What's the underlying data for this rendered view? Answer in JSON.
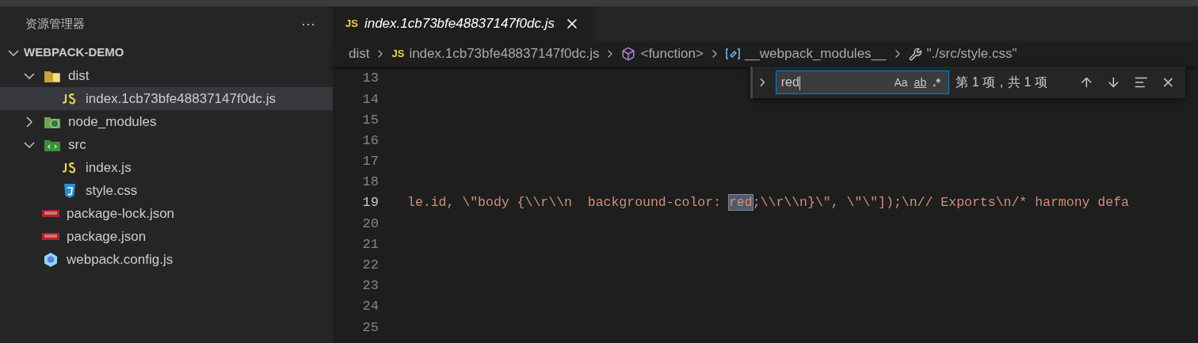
{
  "sidebar": {
    "title": "资源管理器",
    "more": "···",
    "project": {
      "label": "WEBPACK-DEMO",
      "expanded": true,
      "children": [
        {
          "label": "dist",
          "kind": "folder-dist",
          "expanded": true,
          "selected": false,
          "children": [
            {
              "label": "index.1cb73bfe48837147f0dc.js",
              "kind": "js",
              "selected": true
            }
          ]
        },
        {
          "label": "node_modules",
          "kind": "folder-node",
          "expanded": false,
          "selected": false
        },
        {
          "label": "src",
          "kind": "folder-src",
          "expanded": true,
          "selected": false,
          "children": [
            {
              "label": "index.js",
              "kind": "js",
              "selected": false
            },
            {
              "label": "style.css",
              "kind": "css",
              "selected": false
            }
          ]
        },
        {
          "label": "package-lock.json",
          "kind": "npm",
          "selected": false
        },
        {
          "label": "package.json",
          "kind": "npm",
          "selected": false
        },
        {
          "label": "webpack.config.js",
          "kind": "webpack",
          "selected": false
        }
      ]
    }
  },
  "tabs": [
    {
      "label": "index.1cb73bfe48837147f0dc.js",
      "badge": "JS",
      "selected": true
    }
  ],
  "breadcrumbs": [
    {
      "label": "dist",
      "kind": "text"
    },
    {
      "label": "index.1cb73bfe48837147f0dc.js",
      "kind": "js",
      "badge": "JS"
    },
    {
      "label": "<function>",
      "kind": "function"
    },
    {
      "label": "__webpack_modules__",
      "kind": "variable"
    },
    {
      "label": "\"./src/style.css\"",
      "kind": "key"
    }
  ],
  "find": {
    "value": "red",
    "case_label": "Aa",
    "word_label": "ab",
    "regex_label": ".*",
    "result": "第 1 项，共 1 项"
  },
  "lines": [
    {
      "number": "13"
    },
    {
      "number": "14"
    },
    {
      "number": "15"
    },
    {
      "number": "16"
    },
    {
      "number": "17"
    },
    {
      "number": "18"
    },
    {
      "number": "19",
      "current": true,
      "before": "le.id, \\\"body {\\\\r\\\\n  background-color: ",
      "match": "red",
      "after": ";\\\\r\\\\n}\\\", \\\"\\\"]);\\n// Exports\\n/* harmony defa"
    },
    {
      "number": "20"
    },
    {
      "number": "21"
    },
    {
      "number": "22"
    },
    {
      "number": "23"
    },
    {
      "number": "24"
    },
    {
      "number": "25"
    }
  ]
}
